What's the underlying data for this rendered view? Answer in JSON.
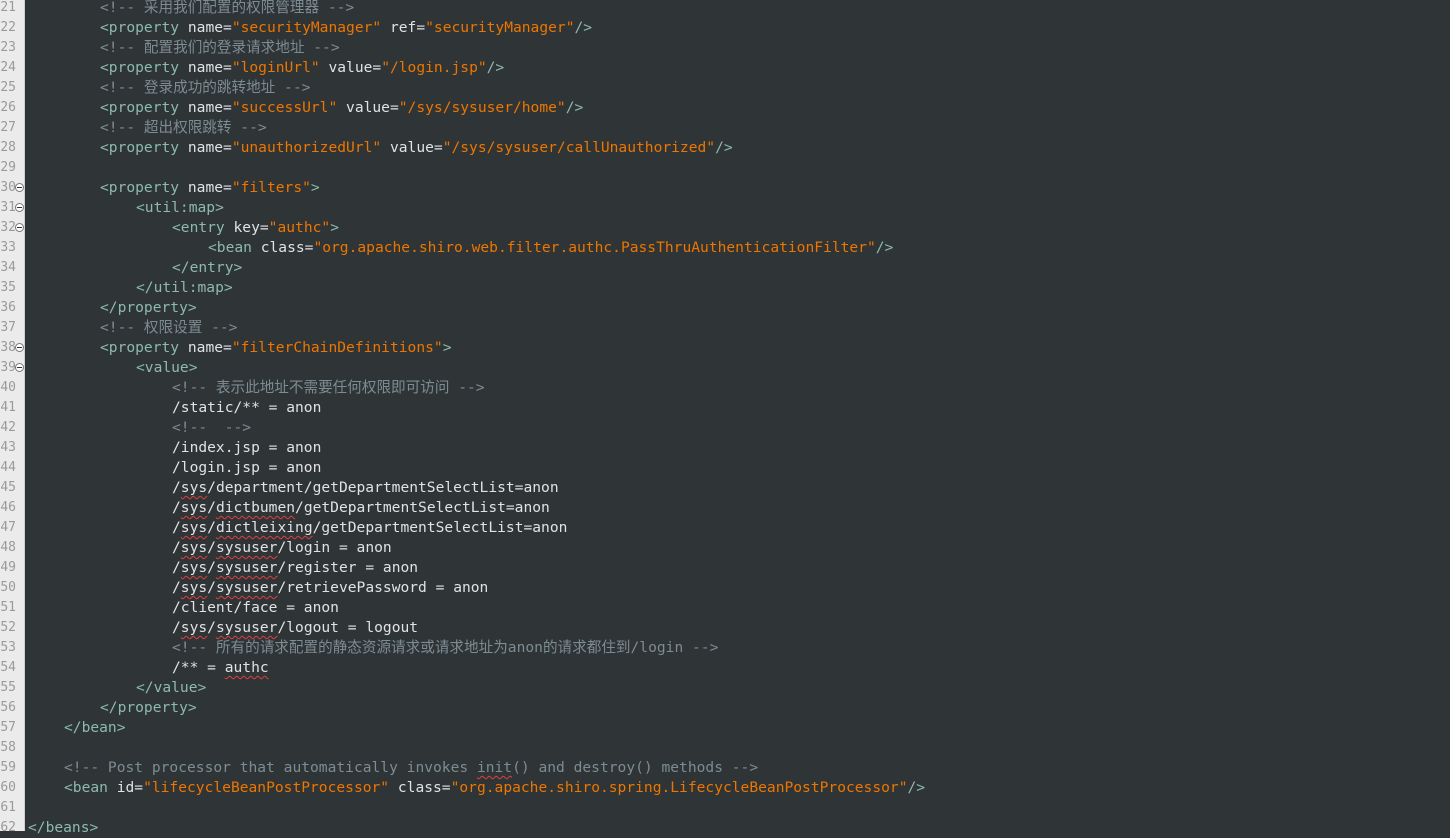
{
  "colors": {
    "background": "#2f3436",
    "gutter": "#ebebeb",
    "line_number": "#9a9a9a",
    "tag": "#8cbbad",
    "attribute": "#e0e2e4",
    "string": "#ec7600",
    "comment": "#7d8c93",
    "text": "#e0e2e4",
    "spell_error": "#e04040"
  },
  "editor": {
    "lines": [
      {
        "n": "21",
        "indent": 2,
        "fold": false,
        "tokens": [
          {
            "t": "c",
            "v": "<!-- 采用我们配置的权限管理器 -->"
          }
        ]
      },
      {
        "n": "22",
        "indent": 2,
        "fold": false,
        "tokens": [
          {
            "t": "g",
            "v": "<property "
          },
          {
            "t": "a",
            "v": "name="
          },
          {
            "t": "s",
            "v": "\"securityManager\""
          },
          {
            "t": "a",
            "v": " ref="
          },
          {
            "t": "s",
            "v": "\"securityManager\""
          },
          {
            "t": "g",
            "v": "/>"
          }
        ]
      },
      {
        "n": "23",
        "indent": 2,
        "fold": false,
        "tokens": [
          {
            "t": "c",
            "v": "<!-- 配置我们的登录请求地址 -->"
          }
        ]
      },
      {
        "n": "24",
        "indent": 2,
        "fold": false,
        "tokens": [
          {
            "t": "g",
            "v": "<property "
          },
          {
            "t": "a",
            "v": "name="
          },
          {
            "t": "s",
            "v": "\"loginUrl\""
          },
          {
            "t": "a",
            "v": " value="
          },
          {
            "t": "s",
            "v": "\"/login.jsp\""
          },
          {
            "t": "g",
            "v": "/>"
          }
        ]
      },
      {
        "n": "25",
        "indent": 2,
        "fold": false,
        "tokens": [
          {
            "t": "c",
            "v": "<!-- 登录成功的跳转地址 -->"
          }
        ]
      },
      {
        "n": "26",
        "indent": 2,
        "fold": false,
        "tokens": [
          {
            "t": "g",
            "v": "<property "
          },
          {
            "t": "a",
            "v": "name="
          },
          {
            "t": "s",
            "v": "\"successUrl\""
          },
          {
            "t": "a",
            "v": " value="
          },
          {
            "t": "s",
            "v": "\"/sys/sysuser/home\""
          },
          {
            "t": "g",
            "v": "/>"
          }
        ]
      },
      {
        "n": "27",
        "indent": 2,
        "fold": false,
        "tokens": [
          {
            "t": "c",
            "v": "<!-- 超出权限跳转 -->"
          }
        ]
      },
      {
        "n": "28",
        "indent": 2,
        "fold": false,
        "tokens": [
          {
            "t": "g",
            "v": "<property "
          },
          {
            "t": "a",
            "v": "name="
          },
          {
            "t": "s",
            "v": "\"unauthorizedUrl\""
          },
          {
            "t": "a",
            "v": " value="
          },
          {
            "t": "s",
            "v": "\"/sys/sysuser/callUnauthorized\""
          },
          {
            "t": "g",
            "v": "/>"
          }
        ]
      },
      {
        "n": "29",
        "indent": 0,
        "fold": false,
        "tokens": []
      },
      {
        "n": "30",
        "indent": 2,
        "fold": true,
        "tokens": [
          {
            "t": "g",
            "v": "<property "
          },
          {
            "t": "a",
            "v": "name="
          },
          {
            "t": "s",
            "v": "\"filters\""
          },
          {
            "t": "g",
            "v": ">"
          }
        ]
      },
      {
        "n": "31",
        "indent": 3,
        "fold": true,
        "tokens": [
          {
            "t": "g",
            "v": "<util:map>"
          }
        ]
      },
      {
        "n": "32",
        "indent": 4,
        "fold": true,
        "tokens": [
          {
            "t": "g",
            "v": "<entry "
          },
          {
            "t": "a",
            "v": "key="
          },
          {
            "t": "s",
            "v": "\"authc\""
          },
          {
            "t": "g",
            "v": ">"
          }
        ]
      },
      {
        "n": "33",
        "indent": 5,
        "fold": false,
        "tokens": [
          {
            "t": "g",
            "v": "<bean "
          },
          {
            "t": "a",
            "v": "class="
          },
          {
            "t": "s",
            "v": "\"org.apache.shiro.web.filter.authc.PassThruAuthenticationFilter\""
          },
          {
            "t": "g",
            "v": "/>"
          }
        ]
      },
      {
        "n": "34",
        "indent": 4,
        "fold": false,
        "tokens": [
          {
            "t": "g",
            "v": "</entry>"
          }
        ]
      },
      {
        "n": "35",
        "indent": 3,
        "fold": false,
        "tokens": [
          {
            "t": "g",
            "v": "</util:map>"
          }
        ]
      },
      {
        "n": "36",
        "indent": 2,
        "fold": false,
        "tokens": [
          {
            "t": "g",
            "v": "</property>"
          }
        ]
      },
      {
        "n": "37",
        "indent": 2,
        "fold": false,
        "tokens": [
          {
            "t": "c",
            "v": "<!-- 权限设置 -->"
          }
        ]
      },
      {
        "n": "38",
        "indent": 2,
        "fold": true,
        "tokens": [
          {
            "t": "g",
            "v": "<property "
          },
          {
            "t": "a",
            "v": "name="
          },
          {
            "t": "s",
            "v": "\"filterChainDefinitions\""
          },
          {
            "t": "g",
            "v": ">"
          }
        ]
      },
      {
        "n": "39",
        "indent": 3,
        "fold": true,
        "tokens": [
          {
            "t": "g",
            "v": "<value>"
          }
        ]
      },
      {
        "n": "40",
        "indent": 4,
        "fold": false,
        "tokens": [
          {
            "t": "c",
            "v": "<!-- 表示此地址不需要任何权限即可访问 -->"
          }
        ]
      },
      {
        "n": "41",
        "indent": 4,
        "fold": false,
        "tokens": [
          {
            "t": "x",
            "v": "/static/** = anon"
          }
        ]
      },
      {
        "n": "42",
        "indent": 4,
        "fold": false,
        "tokens": [
          {
            "t": "c",
            "v": "<!--  -->"
          }
        ]
      },
      {
        "n": "43",
        "indent": 4,
        "fold": false,
        "tokens": [
          {
            "t": "x",
            "v": "/index.jsp = anon"
          }
        ]
      },
      {
        "n": "44",
        "indent": 4,
        "fold": false,
        "tokens": [
          {
            "t": "x",
            "v": "/login.jsp = anon"
          }
        ]
      },
      {
        "n": "45",
        "indent": 4,
        "fold": false,
        "tokens": [
          {
            "t": "x",
            "v": "/"
          },
          {
            "t": "xs",
            "v": "sys"
          },
          {
            "t": "x",
            "v": "/department/getDepartmentSelectList=anon"
          }
        ]
      },
      {
        "n": "46",
        "indent": 4,
        "fold": false,
        "tokens": [
          {
            "t": "x",
            "v": "/"
          },
          {
            "t": "xs",
            "v": "sys"
          },
          {
            "t": "x",
            "v": "/"
          },
          {
            "t": "xs",
            "v": "dictbumen"
          },
          {
            "t": "x",
            "v": "/getDepartmentSelectList=anon"
          }
        ]
      },
      {
        "n": "47",
        "indent": 4,
        "fold": false,
        "tokens": [
          {
            "t": "x",
            "v": "/"
          },
          {
            "t": "xs",
            "v": "sys"
          },
          {
            "t": "x",
            "v": "/"
          },
          {
            "t": "xs",
            "v": "dictleixing"
          },
          {
            "t": "x",
            "v": "/getDepartmentSelectList=anon"
          }
        ]
      },
      {
        "n": "48",
        "indent": 4,
        "fold": false,
        "tokens": [
          {
            "t": "x",
            "v": "/"
          },
          {
            "t": "xs",
            "v": "sys"
          },
          {
            "t": "x",
            "v": "/"
          },
          {
            "t": "xs",
            "v": "sysuser"
          },
          {
            "t": "x",
            "v": "/login = anon"
          }
        ]
      },
      {
        "n": "49",
        "indent": 4,
        "fold": false,
        "tokens": [
          {
            "t": "x",
            "v": "/"
          },
          {
            "t": "xs",
            "v": "sys"
          },
          {
            "t": "x",
            "v": "/"
          },
          {
            "t": "xs",
            "v": "sysuser"
          },
          {
            "t": "x",
            "v": "/register = anon"
          }
        ]
      },
      {
        "n": "50",
        "indent": 4,
        "fold": false,
        "tokens": [
          {
            "t": "x",
            "v": "/"
          },
          {
            "t": "xs",
            "v": "sys"
          },
          {
            "t": "x",
            "v": "/"
          },
          {
            "t": "xs",
            "v": "sysuser"
          },
          {
            "t": "x",
            "v": "/retrievePassword = anon"
          }
        ]
      },
      {
        "n": "51",
        "indent": 4,
        "fold": false,
        "tokens": [
          {
            "t": "x",
            "v": "/client/face = anon"
          }
        ]
      },
      {
        "n": "52",
        "indent": 4,
        "fold": false,
        "tokens": [
          {
            "t": "x",
            "v": "/"
          },
          {
            "t": "xs",
            "v": "sys"
          },
          {
            "t": "x",
            "v": "/"
          },
          {
            "t": "xs",
            "v": "sysuser"
          },
          {
            "t": "x",
            "v": "/logout = logout"
          }
        ]
      },
      {
        "n": "53",
        "indent": 4,
        "fold": false,
        "tokens": [
          {
            "t": "c",
            "v": "<!-- 所有的请求配置的静态资源请求或请求地址为anon的请求都住到/login -->"
          }
        ]
      },
      {
        "n": "54",
        "indent": 4,
        "fold": false,
        "tokens": [
          {
            "t": "x",
            "v": "/** = "
          },
          {
            "t": "xs",
            "v": "authc"
          }
        ]
      },
      {
        "n": "55",
        "indent": 3,
        "fold": false,
        "tokens": [
          {
            "t": "g",
            "v": "</value>"
          }
        ]
      },
      {
        "n": "56",
        "indent": 2,
        "fold": false,
        "tokens": [
          {
            "t": "g",
            "v": "</property>"
          }
        ]
      },
      {
        "n": "57",
        "indent": 1,
        "fold": false,
        "tokens": [
          {
            "t": "g",
            "v": "</bean>"
          }
        ]
      },
      {
        "n": "58",
        "indent": 0,
        "fold": false,
        "tokens": []
      },
      {
        "n": "59",
        "indent": 1,
        "fold": false,
        "tokens": [
          {
            "t": "c",
            "v": "<!-- Post processor that automatically invokes "
          },
          {
            "t": "cs",
            "v": "init"
          },
          {
            "t": "c",
            "v": "() and destroy() methods -->"
          }
        ]
      },
      {
        "n": "60",
        "indent": 1,
        "fold": false,
        "tokens": [
          {
            "t": "g",
            "v": "<bean "
          },
          {
            "t": "a",
            "v": "id="
          },
          {
            "t": "s",
            "v": "\"lifecycleBeanPostProcessor\""
          },
          {
            "t": "a",
            "v": " class="
          },
          {
            "t": "s",
            "v": "\"org.apache.shiro.spring.LifecycleBeanPostProcessor\""
          },
          {
            "t": "g",
            "v": "/>"
          }
        ]
      },
      {
        "n": "61",
        "indent": 0,
        "fold": false,
        "tokens": []
      },
      {
        "n": "62",
        "indent": 0,
        "fold": false,
        "tokens": [
          {
            "t": "g",
            "v": "</beans>"
          }
        ]
      }
    ]
  }
}
